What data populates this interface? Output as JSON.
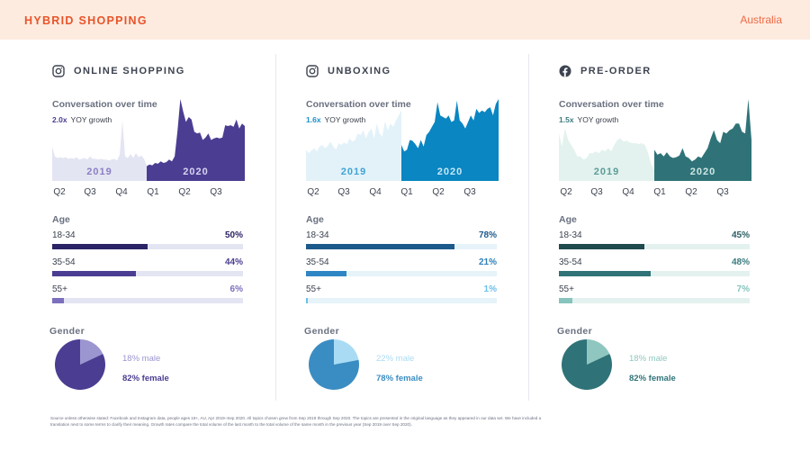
{
  "header": {
    "title": "HYBRID SHOPPING",
    "region": "Australia",
    "title_color": "#e8542a",
    "background": "#fdebe0"
  },
  "columns": [
    {
      "platform_icon": "instagram-icon",
      "topic": "ONLINE SHOPPING",
      "conversation_title": "Conversation over time",
      "yoy_multiplier": "2.0x",
      "yoy_label": "YOY growth",
      "colors": {
        "dark": "#4b3d92",
        "light": "#e4e5f3",
        "year_2019": "#8a80c3",
        "year_2020": "#d8d4f1",
        "accent": "#4b3d92"
      },
      "age_title": "Age",
      "age": [
        {
          "label": "18-34",
          "pct_text": "50%",
          "value": 50,
          "fill": "#2b2466",
          "text_color": "#2b2466",
          "track": "#e4e5f3"
        },
        {
          "label": "35-54",
          "pct_text": "44%",
          "value": 44,
          "fill": "#4b3d92",
          "text_color": "#4b3d92",
          "track": "#e4e5f3"
        },
        {
          "label": "55+",
          "pct_text": "6%",
          "value": 6,
          "fill": "#7b70bd",
          "text_color": "#7b70bd",
          "track": "#e4e5f3"
        }
      ],
      "gender_title": "Gender",
      "gender": {
        "male_text": "18% male",
        "male_value": 18,
        "male_color": "#9b95d0",
        "female_text": "82% female",
        "female_value": 82,
        "female_color": "#4b3d92"
      }
    },
    {
      "platform_icon": "instagram-icon",
      "topic": "UNBOXING",
      "conversation_title": "Conversation over time",
      "yoy_multiplier": "1.6x",
      "yoy_label": "YOY growth",
      "colors": {
        "dark": "#0a86c2",
        "light": "#e3f2f9",
        "year_2019": "#3fa4d3",
        "year_2020": "#c9e8f6",
        "accent": "#1a8fcc"
      },
      "age_title": "Age",
      "age": [
        {
          "label": "18-34",
          "pct_text": "78%",
          "value": 78,
          "fill": "#1d5a8c",
          "text_color": "#1d5a8c",
          "track": "#e6f3f9"
        },
        {
          "label": "35-54",
          "pct_text": "21%",
          "value": 21,
          "fill": "#2f86c4",
          "text_color": "#2f7fba",
          "track": "#e6f3f9"
        },
        {
          "label": "55+",
          "pct_text": "1%",
          "value": 1,
          "fill": "#6bc0ea",
          "text_color": "#6bc0ea",
          "track": "#e6f3f9"
        }
      ],
      "gender_title": "Gender",
      "gender": {
        "male_text": "22% male",
        "male_value": 22,
        "male_color": "#a9dcf4",
        "female_text": "78% female",
        "female_value": 78,
        "female_color": "#3a8dc3"
      }
    },
    {
      "platform_icon": "facebook-icon",
      "topic": "PRE-ORDER",
      "conversation_title": "Conversation over time",
      "yoy_multiplier": "1.5x",
      "yoy_label": "YOY growth",
      "colors": {
        "dark": "#2f7378",
        "light": "#e3f2ee",
        "year_2019": "#5c9c98",
        "year_2020": "#cfe8e6",
        "accent": "#3b7b7e"
      },
      "age_title": "Age",
      "age": [
        {
          "label": "18-34",
          "pct_text": "45%",
          "value": 45,
          "fill": "#1f4a4e",
          "text_color": "#2a5e62",
          "track": "#e4f2ef"
        },
        {
          "label": "35-54",
          "pct_text": "48%",
          "value": 48,
          "fill": "#2f7378",
          "text_color": "#3b7b7e",
          "track": "#e4f2ef"
        },
        {
          "label": "55+",
          "pct_text": "7%",
          "value": 7,
          "fill": "#86c4bd",
          "text_color": "#86c4bd",
          "track": "#e4f2ef"
        }
      ],
      "gender_title": "Gender",
      "gender": {
        "male_text": "18% male",
        "male_value": 18,
        "male_color": "#8fc7c0",
        "female_text": "82% female",
        "female_value": 82,
        "female_color": "#2f7378"
      }
    }
  ],
  "chart_data": [
    {
      "type": "area",
      "title": "Conversation over time",
      "subtitle": "2.0x YOY growth",
      "xlabel": "",
      "ylabel": "",
      "x_ticks": [
        "Q2",
        "Q3",
        "Q4",
        "Q1",
        "Q2",
        "Q3"
      ],
      "ylim": [
        0,
        100
      ],
      "grid": false,
      "series": [
        {
          "name": "2019",
          "values": [
            42,
            30,
            28,
            29,
            28,
            29,
            27,
            28,
            27,
            29,
            26,
            27,
            28,
            26,
            30,
            27,
            27,
            26,
            27,
            26,
            26,
            25,
            26,
            27,
            25,
            32,
            74,
            30,
            28,
            33,
            28,
            34,
            29,
            31,
            27,
            19
          ]
        },
        {
          "name": "2020",
          "values": [
            18,
            20,
            19,
            22,
            21,
            24,
            22,
            23,
            26,
            24,
            30,
            62,
            100,
            85,
            72,
            78,
            75,
            60,
            58,
            59,
            50,
            53,
            58,
            50,
            52,
            53,
            52,
            53,
            68,
            67,
            68,
            66,
            75,
            64,
            70,
            67
          ]
        }
      ]
    },
    {
      "type": "area",
      "title": "Conversation over time",
      "subtitle": "1.6x YOY growth",
      "xlabel": "",
      "ylabel": "",
      "x_ticks": [
        "Q2",
        "Q3",
        "Q4",
        "Q1",
        "Q2",
        "Q3"
      ],
      "ylim": [
        0,
        100
      ],
      "grid": false,
      "series": [
        {
          "name": "2019",
          "values": [
            38,
            34,
            37,
            40,
            36,
            42,
            44,
            40,
            43,
            48,
            42,
            38,
            46,
            44,
            47,
            45,
            52,
            48,
            50,
            58,
            56,
            62,
            52,
            60,
            64,
            52,
            70,
            58,
            54,
            73,
            62,
            70,
            66,
            74,
            80,
            86
          ]
        },
        {
          "name": "2020",
          "values": [
            44,
            36,
            38,
            50,
            49,
            45,
            40,
            50,
            42,
            56,
            60,
            66,
            72,
            96,
            80,
            78,
            76,
            80,
            72,
            74,
            98,
            74,
            70,
            64,
            72,
            80,
            74,
            88,
            83,
            86,
            84,
            88,
            90,
            80,
            94,
            100
          ]
        }
      ]
    },
    {
      "type": "area",
      "title": "Conversation over time",
      "subtitle": "1.5x YOY growth",
      "xlabel": "",
      "ylabel": "",
      "x_ticks": [
        "Q2",
        "Q3",
        "Q4",
        "Q1",
        "Q2",
        "Q3"
      ],
      "ylim": [
        0,
        100
      ],
      "grid": false,
      "series": [
        {
          "name": "2019",
          "values": [
            58,
            42,
            64,
            50,
            44,
            38,
            30,
            30,
            26,
            28,
            34,
            34,
            36,
            34,
            38,
            36,
            40,
            36,
            44,
            50,
            52,
            48,
            49,
            47,
            46,
            46,
            45,
            46,
            44,
            34,
            20,
            14
          ]
        },
        {
          "name": "2020",
          "values": [
            38,
            32,
            34,
            30,
            35,
            30,
            28,
            29,
            31,
            40,
            30,
            28,
            24,
            26,
            30,
            28,
            34,
            40,
            52,
            62,
            50,
            46,
            60,
            58,
            62,
            64,
            70,
            70,
            60,
            58,
            100,
            50
          ]
        }
      ]
    }
  ],
  "footnote": "Source unless otherwise stated: Facebook and Instagram data, people ages 18+, AU, Apr 2019–Sep 2020. All topics chosen grew from Sep 2019 through Sep 2020. The topics are presented in the original language as they appeared in our data set. We have included a translation next to some terms to clarify their meaning. Growth rates compare the total volume of the last month to the total volume of the same month in the previous year (Sep 2019 over Sep 2020)."
}
